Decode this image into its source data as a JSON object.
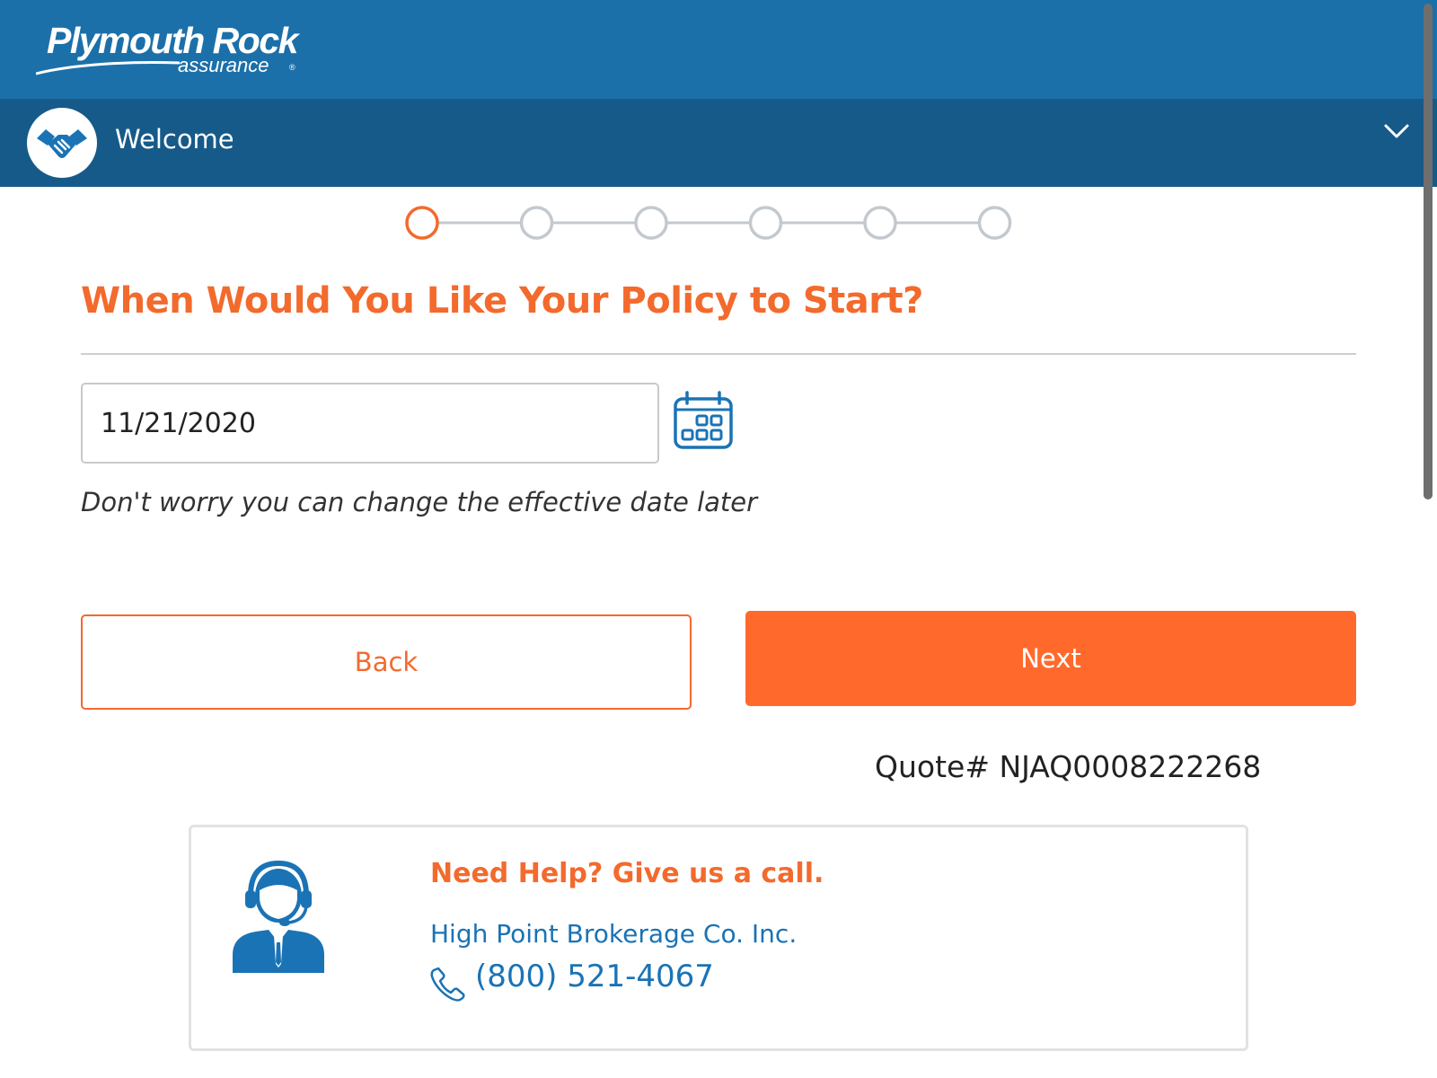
{
  "header": {
    "brand_main": "Plymouth Rock",
    "brand_sub": "assurance",
    "brand_mark": "®",
    "brand_color": "#1c70a9"
  },
  "section_bar": {
    "title": "Welcome",
    "icon": "handshake-icon",
    "expand_icon": "chevron-down-icon",
    "color": "#165a89"
  },
  "stepper": {
    "total_steps": 6,
    "current_step": 1,
    "active_color": "#f36a2d",
    "inactive_color": "#c3c9ce"
  },
  "form": {
    "question": "When Would You Like Your Policy to Start?",
    "start_date_value": "11/21/2020",
    "calendar_icon": "calendar-icon",
    "hint": "Don't worry you can change the effective date later"
  },
  "actions": {
    "back_label": "Back",
    "next_label": "Next",
    "accent_color": "#ff6a2c"
  },
  "quote": {
    "text": "Quote# NJAQ0008222268"
  },
  "help": {
    "title": "Need Help? Give us a call.",
    "organization": "High Point Brokerage Co. Inc.",
    "phone": "(800) 521-4067",
    "agent_icon": "customer-service-agent-icon",
    "phone_icon": "phone-icon",
    "link_color": "#1a73b5"
  }
}
